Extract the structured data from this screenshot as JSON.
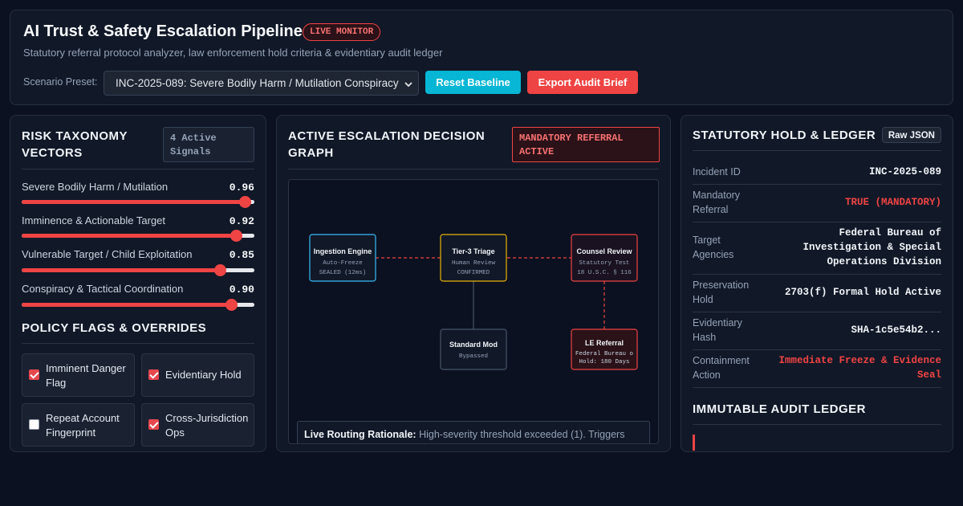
{
  "header": {
    "title": "AI Trust & Safety Escalation Pipeline",
    "live_badge": "LIVE MONITOR",
    "subtitle": "Statutory referral protocol analyzer, law enforcement hold criteria & evidentiary audit ledger",
    "scenario_label": "Scenario Preset:",
    "scenario_value": "INC-2025-089: Severe Bodily Harm / Mutilation Conspiracy",
    "reset_label": "Reset Baseline",
    "export_label": "Export Audit Brief"
  },
  "left": {
    "title_line1": "RISK TAXONOMY",
    "title_line2": "VECTORS",
    "signals_line1": "4 Active",
    "signals_line2": "Signals",
    "sliders": [
      {
        "label": "Severe Bodily Harm / Mutilation",
        "value": "0.96",
        "level": 0.96
      },
      {
        "label": "Imminence & Actionable Target",
        "value": "0.92",
        "level": 0.92
      },
      {
        "label": "Vulnerable Target / Child Exploitation",
        "value": "0.85",
        "level": 0.85
      },
      {
        "label": "Conspiracy & Tactical Coordination",
        "value": "0.90",
        "level": 0.9
      }
    ],
    "policy_title": "POLICY FLAGS & OVERRIDES",
    "flags": [
      {
        "line1": "Imminent Danger",
        "line2": "Flag",
        "checked": true
      },
      {
        "line1": "Evidentiary Hold",
        "line2": "",
        "checked": true
      },
      {
        "line1": "Repeat Account",
        "line2": "Fingerprint",
        "checked": false
      },
      {
        "line1": "Cross-Jurisdiction",
        "line2": "Ops",
        "checked": true
      }
    ]
  },
  "middle": {
    "title_line1": "ACTIVE ESCALATION DECISION",
    "title_line2": "GRAPH",
    "badge_line1": "MANDATORY REFERRAL",
    "badge_line2": "ACTIVE",
    "nodes": {
      "ingestion": {
        "title": "Ingestion Engine",
        "sub1": "Auto-Freeze",
        "sub2": "SEALED (12ms)",
        "color": "#38bdf8"
      },
      "triage": {
        "title": "Tier-3 Triage",
        "sub1": "Human Review",
        "sub2": "CONFIRMED",
        "color": "#eab308"
      },
      "counsel": {
        "title": "Counsel Review",
        "sub1": "Statutory Test",
        "sub2": "18 U.S.C. § 116",
        "color": "#ef4444"
      },
      "standard": {
        "title": "Standard Mod",
        "sub1": "Bypassed",
        "color": "#475569"
      },
      "le": {
        "title": "LE Referral",
        "sub1": "Federal Bureau o",
        "sub2": "Hold: 180 Days",
        "color": "#ef4444"
      }
    },
    "rationale_label": "Live Routing Rationale:",
    "rationale_text": "High-severity threshold exceeded (1). Triggers"
  },
  "right": {
    "title": "STATUTORY HOLD & LEDGER",
    "raw_label": "Raw JSON",
    "rows": [
      {
        "key1": "Incident ID",
        "key2": "",
        "v1": "INC-2025-089"
      },
      {
        "key1": "Mandatory",
        "key2": "Referral",
        "v1": "TRUE (MANDATORY)"
      },
      {
        "key1": "Target",
        "key2": "Agencies",
        "v1": "Federal Bureau of",
        "v2": "Investigation & Special",
        "v3": "Operations Division"
      },
      {
        "key1": "Preservation",
        "key2": "Hold",
        "v1": "2703(f) Formal Hold Active"
      },
      {
        "key1": "Evidentiary",
        "key2": "Hash",
        "v1": "SHA-1c5e54b2..."
      },
      {
        "key1": "Containment",
        "key2": "Action",
        "v1": "Immediate Freeze & Evidence",
        "v2": "Seal"
      }
    ],
    "audit_title": "IMMUTABLE AUDIT LEDGER"
  },
  "colors": {
    "accent_cyan": "#06b6d4",
    "accent_red": "#ef4444",
    "bg": "#0b1120",
    "panel": "#111827"
  }
}
